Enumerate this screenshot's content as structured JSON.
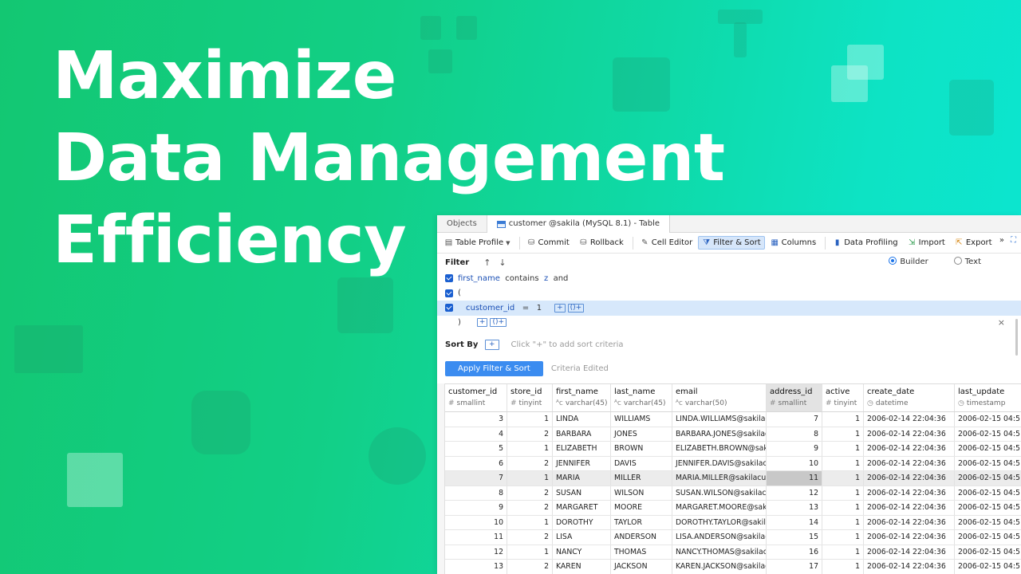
{
  "headline": {
    "line1": "Maximize",
    "line2": "Data Management",
    "line3": "Efficiency"
  },
  "window": {
    "tabs": [
      {
        "label": "Objects"
      },
      {
        "label": "customer @sakila (MySQL 8.1) - Table"
      }
    ],
    "toolbar": {
      "table_profile": "Table Profile",
      "commit": "Commit",
      "rollback": "Rollback",
      "cell_editor": "Cell Editor",
      "filter_sort": "Filter & Sort",
      "columns": "Columns",
      "data_profiling": "Data Profiling",
      "import": "Import",
      "export": "Export"
    },
    "filter": {
      "title": "Filter",
      "mode_builder": "Builder",
      "mode_text": "Text",
      "selected_mode": "Builder",
      "line1": {
        "field": "first_name",
        "op": "contains",
        "value": "z",
        "conj": "and"
      },
      "open_paren": "(",
      "line3": {
        "field": "customer_id",
        "op": "=",
        "value": "1"
      },
      "close_paren": ")",
      "add_symbol": "+",
      "group_symbol": "()+",
      "close_symbol": "×"
    },
    "sort": {
      "title": "Sort By",
      "add_symbol": "+",
      "hint": "Click \"+\" to add sort criteria"
    },
    "apply": {
      "button": "Apply Filter & Sort",
      "status": "Criteria Edited"
    },
    "columns": [
      {
        "name": "customer_id",
        "type": "smallint"
      },
      {
        "name": "store_id",
        "type": "tinyint"
      },
      {
        "name": "first_name",
        "type": "varchar(45)"
      },
      {
        "name": "last_name",
        "type": "varchar(45)"
      },
      {
        "name": "email",
        "type": "varchar(50)"
      },
      {
        "name": "address_id",
        "type": "smallint"
      },
      {
        "name": "active",
        "type": "tinyint"
      },
      {
        "name": "create_date",
        "type": "datetime"
      },
      {
        "name": "last_update",
        "type": "timestamp"
      }
    ],
    "rows": [
      [
        "3",
        "1",
        "LINDA",
        "WILLIAMS",
        "LINDA.WILLIAMS@sakilac",
        "7",
        "1",
        "2006-02-14 22:04:36",
        "2006-02-15 04:5"
      ],
      [
        "4",
        "2",
        "BARBARA",
        "JONES",
        "BARBARA.JONES@sakilac",
        "8",
        "1",
        "2006-02-14 22:04:36",
        "2006-02-15 04:5"
      ],
      [
        "5",
        "1",
        "ELIZABETH",
        "BROWN",
        "ELIZABETH.BROWN@sakil",
        "9",
        "1",
        "2006-02-14 22:04:36",
        "2006-02-15 04:5"
      ],
      [
        "6",
        "2",
        "JENNIFER",
        "DAVIS",
        "JENNIFER.DAVIS@sakilacu",
        "10",
        "1",
        "2006-02-14 22:04:36",
        "2006-02-15 04:5"
      ],
      [
        "7",
        "1",
        "MARIA",
        "MILLER",
        "MARIA.MILLER@sakilacus",
        "11",
        "1",
        "2006-02-14 22:04:36",
        "2006-02-15 04:5"
      ],
      [
        "8",
        "2",
        "SUSAN",
        "WILSON",
        "SUSAN.WILSON@sakilacu",
        "12",
        "1",
        "2006-02-14 22:04:36",
        "2006-02-15 04:5"
      ],
      [
        "9",
        "2",
        "MARGARET",
        "MOORE",
        "MARGARET.MOORE@saki",
        "13",
        "1",
        "2006-02-14 22:04:36",
        "2006-02-15 04:5"
      ],
      [
        "10",
        "1",
        "DOROTHY",
        "TAYLOR",
        "DOROTHY.TAYLOR@sakil",
        "14",
        "1",
        "2006-02-14 22:04:36",
        "2006-02-15 04:5"
      ],
      [
        "11",
        "2",
        "LISA",
        "ANDERSON",
        "LISA.ANDERSON@sakilac",
        "15",
        "1",
        "2006-02-14 22:04:36",
        "2006-02-15 04:5"
      ],
      [
        "12",
        "1",
        "NANCY",
        "THOMAS",
        "NANCY.THOMAS@sakilac",
        "16",
        "1",
        "2006-02-14 22:04:36",
        "2006-02-15 04:5"
      ],
      [
        "13",
        "2",
        "KAREN",
        "JACKSON",
        "KAREN.JACKSON@sakilac",
        "17",
        "1",
        "2006-02-14 22:04:36",
        "2006-02-15 04:5"
      ]
    ],
    "selected_row_index": 4,
    "selected_column_index": 5,
    "accent_color": "#3b8cf0"
  }
}
